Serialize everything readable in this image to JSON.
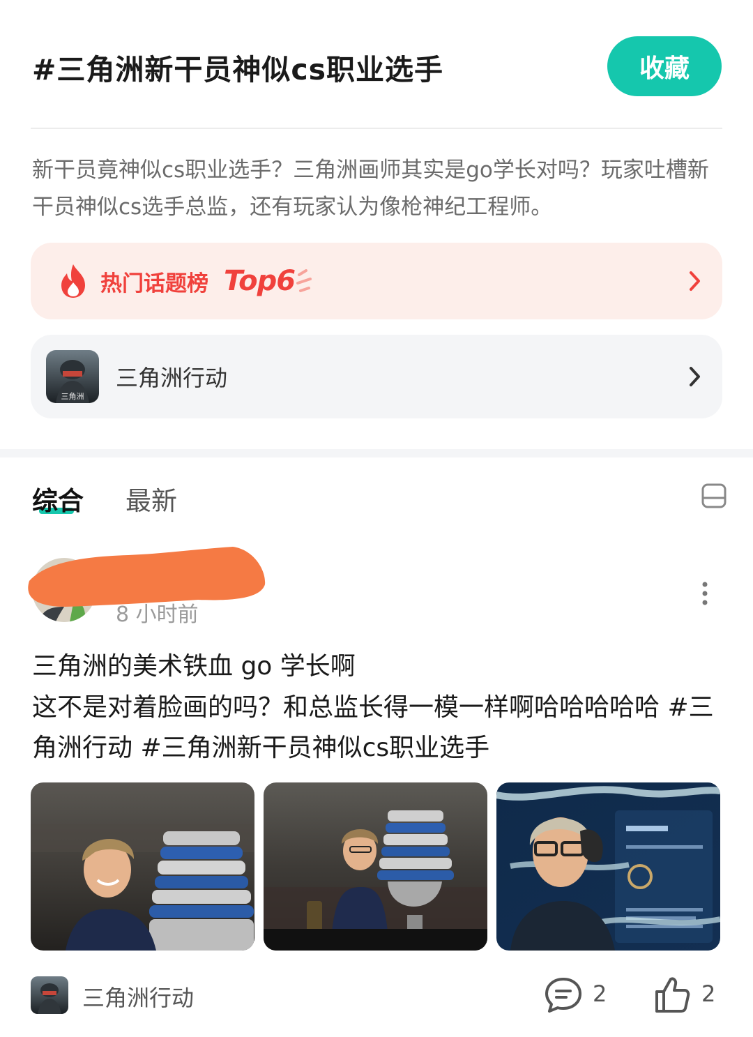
{
  "header": {
    "title": "#三角洲新干员神似cs职业选手",
    "favorite_label": "收藏",
    "description": "新干员竟神似cs职业选手？三角洲画师其实是go学长对吗？玩家吐槽新干员神似cs选手总监，还有玩家认为像枪神纪工程师。"
  },
  "hot_rank": {
    "label": "热门话题榜",
    "badge": "Top6",
    "accent_color": "#f0413c"
  },
  "game_card": {
    "name": "三角洲行动",
    "icon": "game-logo"
  },
  "tabs": [
    {
      "label": "综合",
      "active": true
    },
    {
      "label": "最新",
      "active": false
    }
  ],
  "post": {
    "time": "8 小时前",
    "title": "三角洲的美术铁血 go 学长啊",
    "body": "这不是对着脸画的吗？和总监长得一模一样啊哈哈哈哈哈 #三角洲行动 #三角洲新干员神似cs职业选手",
    "images": [
      "trophy-photo-1",
      "trophy-photo-2",
      "game-character-photo"
    ],
    "footer": {
      "game_name": "三角洲行动",
      "comments": "2",
      "likes": "2"
    }
  },
  "colors": {
    "accent": "#15c7ad",
    "hot": "#f0413c",
    "redaction": "#f57a44"
  }
}
